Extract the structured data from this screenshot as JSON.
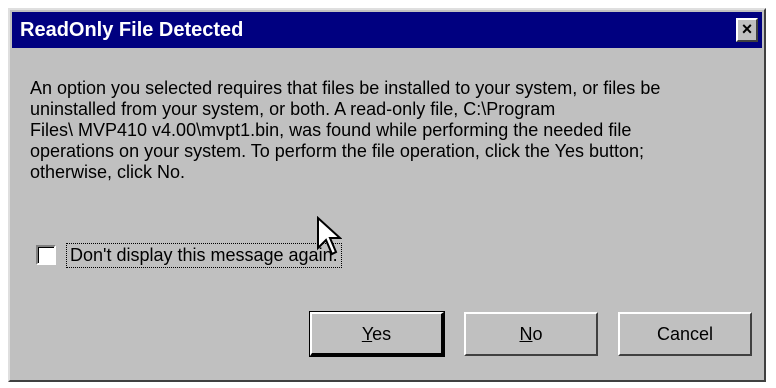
{
  "window": {
    "title": "ReadOnly File Detected",
    "close_glyph": "×"
  },
  "message": {
    "text": "An option you selected requires that files be installed to your system, or files be\nuninstalled from your system, or both. A read-only file, C:\\Program\nFiles\\  MVP410 v4.00\\mvpt1.bin, was found while performing the needed file\noperations on your system. To perform the file operation, click the Yes button;\notherwise, click No."
  },
  "checkbox": {
    "label": "Don't display this message again.",
    "checked": false
  },
  "buttons": {
    "yes": {
      "mnemonic": "Y",
      "rest": "es"
    },
    "no": {
      "mnemonic": "N",
      "rest": "o"
    },
    "cancel": {
      "label": "Cancel"
    }
  },
  "colors": {
    "titlebar": "#000080",
    "face": "#c0c0c0"
  }
}
